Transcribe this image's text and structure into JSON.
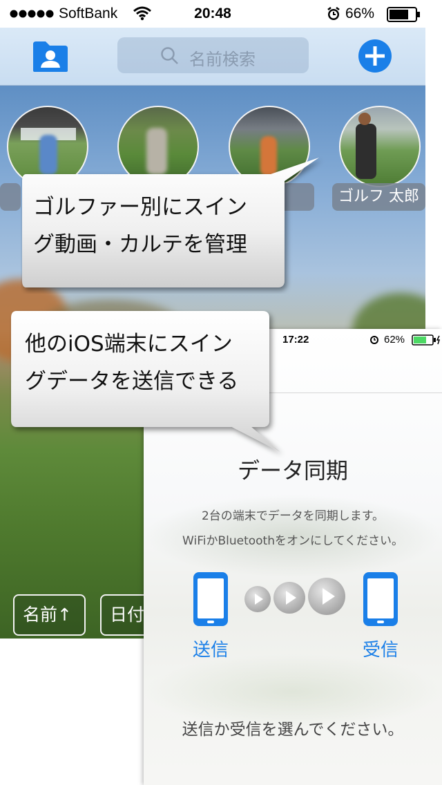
{
  "back_screen": {
    "status": {
      "carrier": "SoftBank",
      "time": "20:48",
      "battery": "66%"
    },
    "search": {
      "placeholder": "名前検索"
    },
    "golfer_label": "ゴルフ 太郎",
    "sort_buttons": [
      "名前↑",
      "日付"
    ]
  },
  "front_screen": {
    "status": {
      "time": "17:22",
      "battery": "62%"
    },
    "title": "データ同期",
    "desc_line1": "2台の端末でデータを同期します。",
    "desc_line2": "WiFiかBluetoothをオンにしてください。",
    "send_label": "送信",
    "receive_label": "受信",
    "prompt": "送信か受信を選んでください。"
  },
  "callouts": {
    "top": {
      "line1": "ゴルファー別にスイン",
      "line2": "グ動画・カルテを管理"
    },
    "bottom": {
      "line1": "他のiOS端末にスイン",
      "line2": "グデータを送信できる"
    }
  },
  "colors": {
    "accent_blue": "#1a7fe8",
    "battery_green": "#4cd964"
  }
}
